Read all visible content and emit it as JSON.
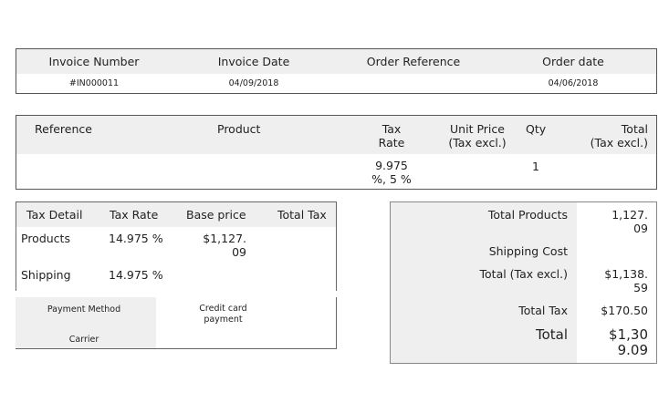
{
  "info_table": {
    "headers": [
      "Invoice Number",
      "Invoice Date",
      "Order Reference",
      "Order date"
    ],
    "values": [
      "#IN000011",
      "04/09/2018",
      "",
      "04/06/2018"
    ]
  },
  "product_table": {
    "headers": {
      "reference": "Reference",
      "product": "Product",
      "tax_rate": [
        "Tax",
        "Rate"
      ],
      "unit_price": [
        "Unit Price",
        "(Tax excl.)"
      ],
      "qty": "Qty",
      "total": [
        "Total",
        "(Tax excl.)"
      ]
    },
    "row": {
      "reference": "",
      "product": "",
      "tax_rate": [
        "9.975",
        "%, 5 %"
      ],
      "unit_price": "",
      "qty": "1",
      "total": ""
    }
  },
  "tax_table": {
    "headers": [
      "Tax Detail",
      "Tax Rate",
      "Base price",
      "Total Tax"
    ],
    "rows": [
      {
        "detail": "Products",
        "rate": "14.975 %",
        "base": [
          "$1,127.",
          "09"
        ],
        "total": ""
      },
      {
        "detail": "Shipping",
        "rate": "14.975 %",
        "base": [
          "",
          ""
        ],
        "total": ""
      }
    ]
  },
  "payment": {
    "method_label": "Payment Method",
    "method_value": [
      "Credit card",
      "payment"
    ],
    "carrier_label": "Carrier",
    "carrier_value": ""
  },
  "totals": {
    "products_label": "Total Products",
    "products_value": [
      "1,127.",
      "09"
    ],
    "shipping_label": "Shipping Cost",
    "shipping_value": "",
    "tax_excl_label": "Total (Tax excl.)",
    "tax_excl_value": [
      "$1,138.",
      "59"
    ],
    "tax_label": "Total Tax",
    "tax_value": "$170.50",
    "total_label": "Total",
    "total_value": [
      "$1,30",
      "9.09"
    ]
  }
}
